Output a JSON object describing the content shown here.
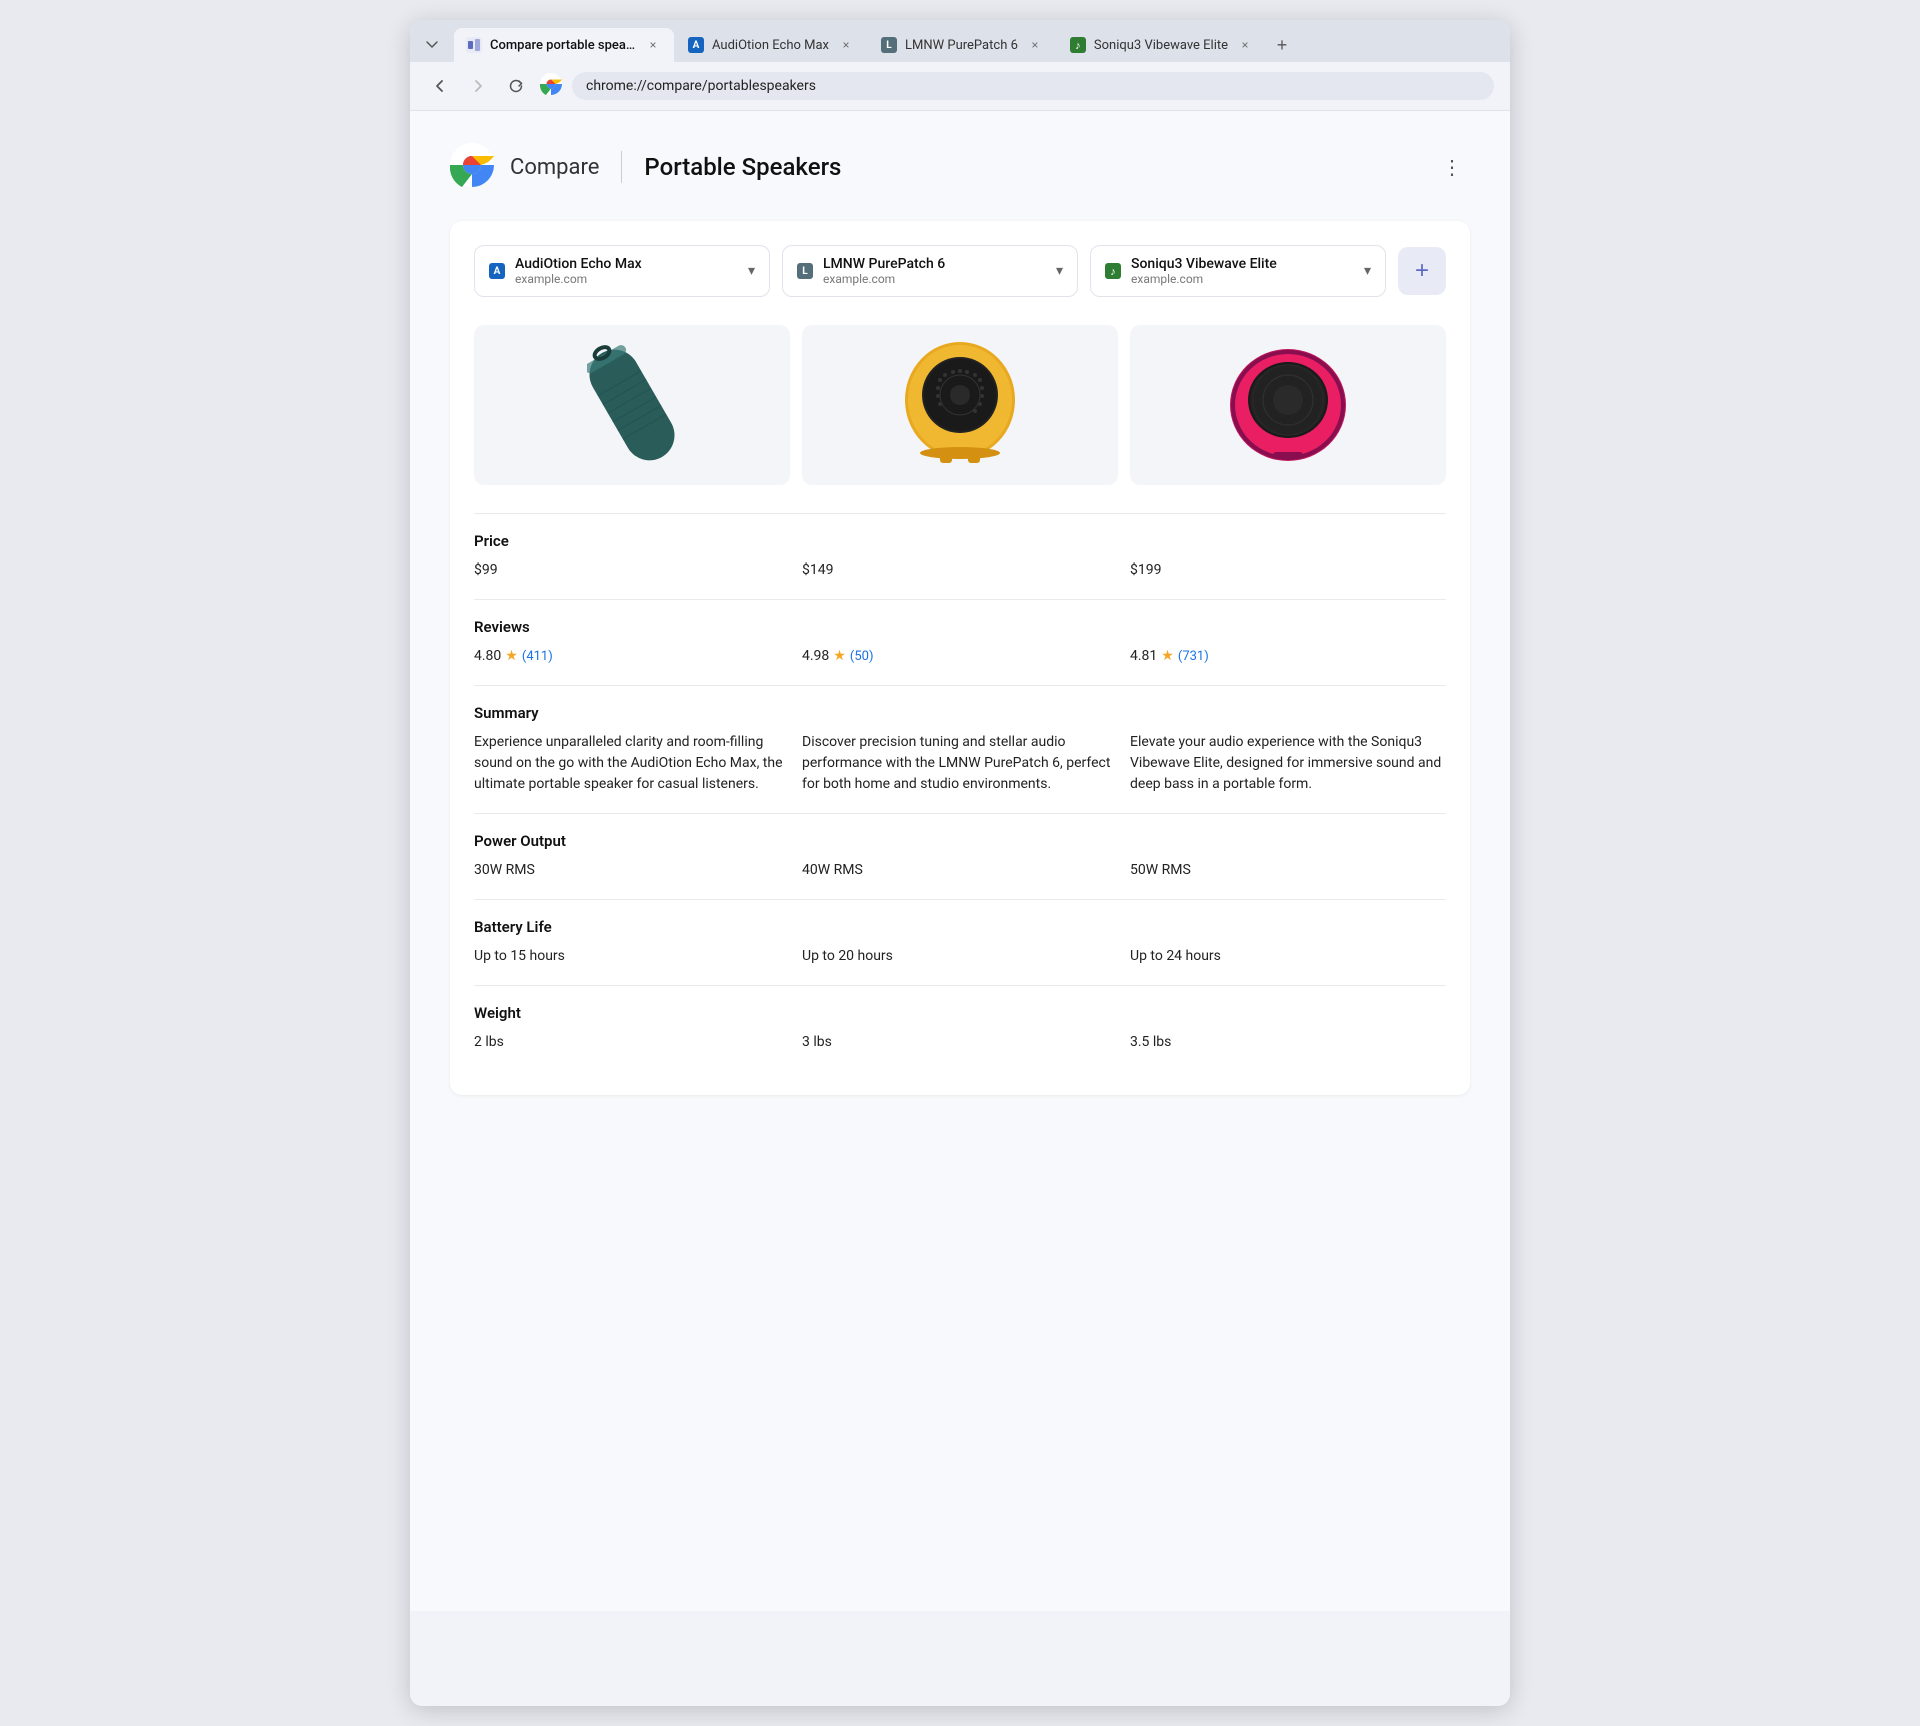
{
  "browser": {
    "tabs": [
      {
        "id": "compare",
        "title": "Compare portable speaker",
        "favicon_type": "compare",
        "active": true
      },
      {
        "id": "echo",
        "title": "AudiOtion Echo Max",
        "favicon_type": "blue",
        "active": false
      },
      {
        "id": "purepatch",
        "title": "LMNW PurePatch 6",
        "favicon_type": "gray",
        "active": false
      },
      {
        "id": "vibewave",
        "title": "Soniqu3 Vibewave Elite",
        "favicon_type": "green",
        "active": false
      }
    ],
    "url": "chrome://compare/portablespeakers",
    "url_icon": "chrome"
  },
  "page": {
    "brand": "Compare",
    "title": "Portable Speakers",
    "more_label": "⋮"
  },
  "products": [
    {
      "name": "AudiOtion Echo Max",
      "domain": "example.com",
      "favicon_type": "blue",
      "price": "$99",
      "rating": "4.80",
      "review_count": "411",
      "summary": "Experience unparalleled clarity and room-filling sound on the go with the AudiOtion Echo Max, the ultimate portable speaker for casual listeners.",
      "power_output": "30W RMS",
      "battery_life": "Up to 15 hours",
      "weight": "2 lbs"
    },
    {
      "name": "LMNW PurePatch 6",
      "domain": "example.com",
      "favicon_type": "gray",
      "price": "$149",
      "rating": "4.98",
      "review_count": "50",
      "summary": "Discover precision tuning and stellar audio performance with the LMNW PurePatch 6, perfect for both home and studio environments.",
      "power_output": "40W RMS",
      "battery_life": "Up to 20 hours",
      "weight": "3 lbs"
    },
    {
      "name": "Soniqu3 Vibewave Elite",
      "domain": "example.com",
      "favicon_type": "green",
      "price": "$199",
      "rating": "4.81",
      "review_count": "731",
      "summary": "Elevate your audio experience with the Soniqu3 Vibewave Elite, designed for immersive sound and deep bass in a portable form.",
      "power_output": "50W RMS",
      "battery_life": "Up to 24 hours",
      "weight": "3.5 lbs"
    }
  ],
  "compare_rows": [
    {
      "label": "Price"
    },
    {
      "label": "Reviews"
    },
    {
      "label": "Summary"
    },
    {
      "label": "Power Output"
    },
    {
      "label": "Battery Life"
    },
    {
      "label": "Weight"
    }
  ],
  "add_button_label": "+",
  "nav": {
    "back_disabled": false,
    "forward_disabled": true
  }
}
